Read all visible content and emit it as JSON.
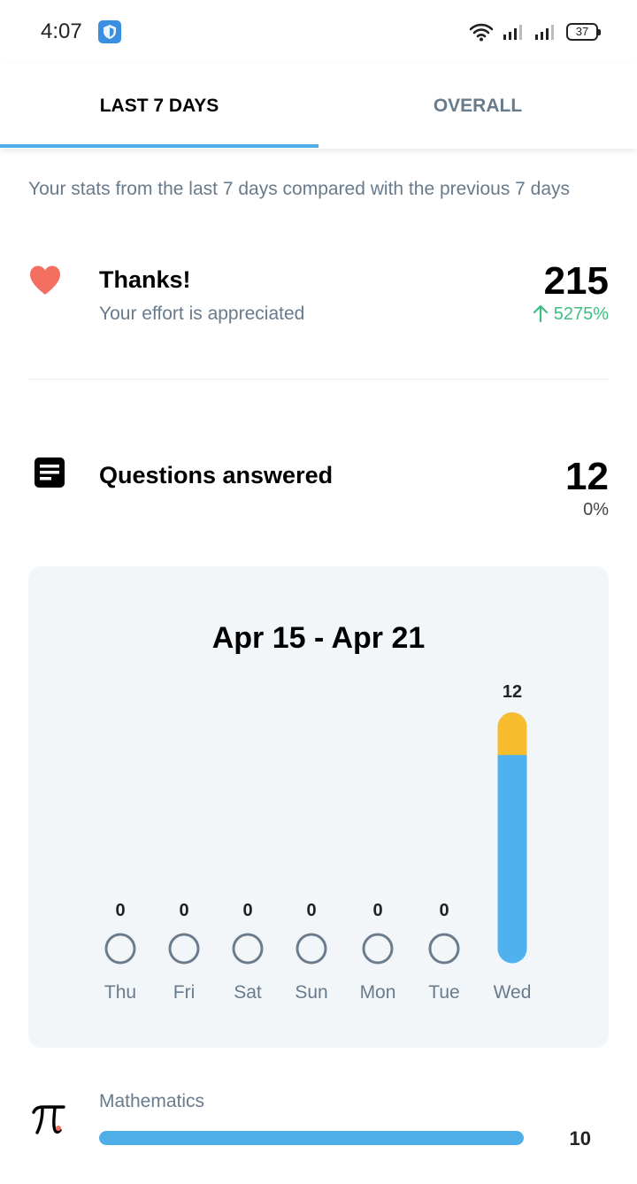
{
  "status_bar": {
    "time": "4:07",
    "battery": "37",
    "icons": [
      "shield-app-icon",
      "wifi-icon",
      "signal-icon",
      "signal-icon",
      "battery-icon"
    ]
  },
  "tabs": [
    {
      "label": "LAST 7 DAYS",
      "active": true
    },
    {
      "label": "OVERALL",
      "active": false
    }
  ],
  "intro": "Your stats from the last 7 days compared with the previous 7 days",
  "thanks": {
    "title": "Thanks!",
    "subtitle": "Your effort is appreciated",
    "value": "215",
    "change": "5275%",
    "change_direction": "up",
    "icon": "heart-icon",
    "color": "#f36f5f",
    "change_color": "#3dbf82"
  },
  "questions": {
    "title": "Questions answered",
    "value": "12",
    "change": "0%",
    "icon": "document-icon"
  },
  "chart_data": {
    "type": "bar",
    "title": "Apr 15 - Apr 21",
    "categories": [
      "Thu",
      "Fri",
      "Sat",
      "Sun",
      "Mon",
      "Tue",
      "Wed"
    ],
    "values": [
      0,
      0,
      0,
      0,
      0,
      0,
      12
    ],
    "highlight": {
      "category": "Wed",
      "fraction": 0.17,
      "color": "#f8bd2e"
    },
    "bar_color": "#4fb2ee",
    "empty_marker_color": "#6b7c8d",
    "grid": false
  },
  "subjects": [
    {
      "name": "Mathematics",
      "count": "10",
      "icon": "pi-icon",
      "fraction": 1.0
    }
  ]
}
